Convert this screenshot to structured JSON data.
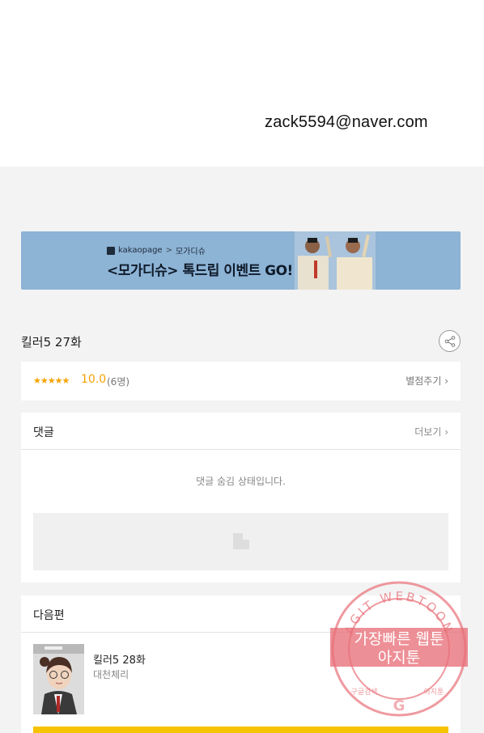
{
  "header": {
    "email": "zack5594@naver.com"
  },
  "banner": {
    "brand": "kakaopage",
    "separator": ">",
    "brand_sub": "모가디슈",
    "title": "<모가디슈> 톡드립 이벤트 GO!"
  },
  "episode": {
    "title": "킬러5 27화"
  },
  "rating": {
    "stars": "★★★★★",
    "score": "10.0",
    "count": "(6명)",
    "rate_link": "별점주기 ›"
  },
  "comments": {
    "title": "댓글",
    "more_link": "더보기 ›",
    "hidden_message": "댓글 숨김 상태입니다."
  },
  "next_episode": {
    "section_title": "다음편",
    "title": "킬러5 28화",
    "author": "대천체리"
  },
  "watermark": {
    "ring_text": "AGIT WEBTOON",
    "line1": "가장빠른 웹툰",
    "line2": "아지툰",
    "bottom_left": "구글검색",
    "bottom_right": "아지툰",
    "google_letter": "G"
  },
  "colors": {
    "accent_star": "#f5a200",
    "banner_bg": "#8db3d5",
    "cta": "#f7c200",
    "watermark": "#e86f78"
  }
}
